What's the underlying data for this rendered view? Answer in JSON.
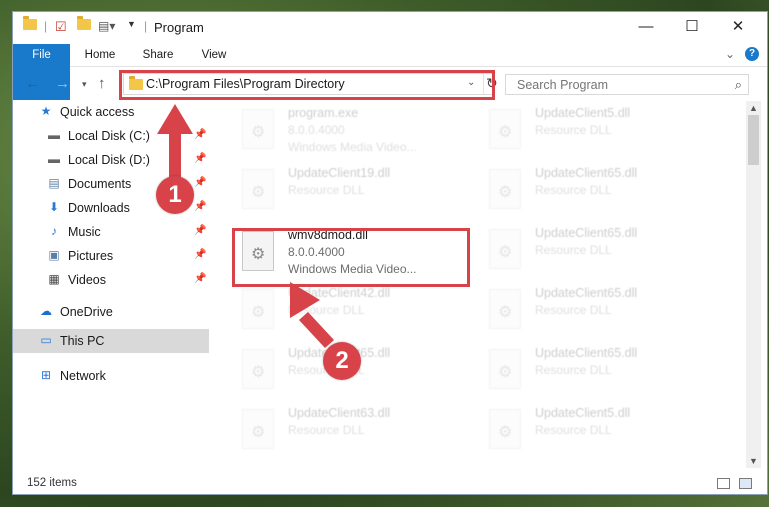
{
  "window": {
    "title": "Program",
    "controls": {
      "minimize": "—",
      "maximize": "☐",
      "close": "✕"
    }
  },
  "ribbon": {
    "tabs": [
      "File",
      "Home",
      "Share",
      "View"
    ],
    "collapse_icon": "chevron-down-icon",
    "help": "?"
  },
  "address_bar": {
    "path": "C:\\Program Files\\Program Directory",
    "refresh_icon": "refresh-icon"
  },
  "search": {
    "placeholder": "Search Program"
  },
  "sidebar": {
    "items": [
      {
        "label": "Quick access",
        "icon": "star-icon",
        "pinned": false
      },
      {
        "label": "Local Disk (C:)",
        "icon": "drive-icon",
        "pinned": true
      },
      {
        "label": "Local Disk (D:)",
        "icon": "drive-icon",
        "pinned": true
      },
      {
        "label": "Documents",
        "icon": "document-icon",
        "pinned": true
      },
      {
        "label": "Downloads",
        "icon": "download-icon",
        "pinned": true
      },
      {
        "label": "Music",
        "icon": "music-icon",
        "pinned": true
      },
      {
        "label": "Pictures",
        "icon": "pictures-icon",
        "pinned": true
      },
      {
        "label": "Videos",
        "icon": "video-icon",
        "pinned": true
      },
      {
        "label": "OneDrive",
        "icon": "cloud-icon",
        "pinned": false
      },
      {
        "label": "This PC",
        "icon": "monitor-icon",
        "pinned": false,
        "selected": true
      },
      {
        "label": "Network",
        "icon": "network-icon",
        "pinned": false
      }
    ]
  },
  "files": [
    {
      "name": "program.exe",
      "line2": "8.0.0.4000",
      "line3": "Windows Media Video...",
      "faded": true
    },
    {
      "name": "UpdateClient5.dll",
      "line2": "Resource DLL",
      "line3": "",
      "faded": true
    },
    {
      "name": "UpdateClient19.dll",
      "line2": "Resource DLL",
      "line3": "",
      "faded": true
    },
    {
      "name": "UpdateClient65.dll",
      "line2": "Resource DLL",
      "line3": "",
      "faded": true
    },
    {
      "name": "wmv8dmod.dll",
      "line2": "8.0.0.4000",
      "line3": "Windows Media Video...",
      "faded": false
    },
    {
      "name": "UpdateClient65.dll",
      "line2": "Resource DLL",
      "line3": "",
      "faded": true
    },
    {
      "name": "UpdateClient42.dll",
      "line2": "Resource DLL",
      "line3": "",
      "faded": true
    },
    {
      "name": "UpdateClient65.dll",
      "line2": "Resource DLL",
      "line3": "",
      "faded": true
    },
    {
      "name": "UpdateClient65.dll",
      "line2": "Resource DLL",
      "line3": "",
      "faded": true
    },
    {
      "name": "UpdateClient65.dll",
      "line2": "Resource DLL",
      "line3": "",
      "faded": true
    },
    {
      "name": "UpdateClient63.dll",
      "line2": "Resource DLL",
      "line3": "",
      "faded": true
    },
    {
      "name": "UpdateClient5.dll",
      "line2": "Resource DLL",
      "line3": "",
      "faded": true
    }
  ],
  "status": {
    "item_count": "152 items"
  },
  "annotations": {
    "step1": "1",
    "step2": "2",
    "color": "#d8434a"
  },
  "colors": {
    "file_tab": "#1979ca",
    "selection": "#d9d9d9"
  }
}
